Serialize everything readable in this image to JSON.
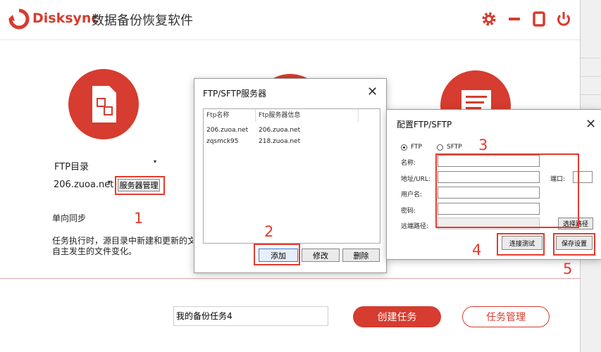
{
  "app": {
    "brand": "Disksync",
    "title": "数据备份恢复软件",
    "controls": {
      "settings": "gear-icon",
      "minimize": "minimize-icon",
      "maximize": "maximize-icon",
      "power": "power-icon"
    }
  },
  "left_panel": {
    "dir_type": "FTP目录",
    "server_value": "206.zuoa.net",
    "server_btn": "服务器管理",
    "mode": "单向同步",
    "desc_line1": "任务执行时，源目录中新建和更新的文",
    "desc_line2": "自主发生的文件变化。"
  },
  "bottom": {
    "task_name": "我的备份任务4",
    "create_btn": "创建任务",
    "manage_btn": "任务管理"
  },
  "ftp_dialog": {
    "title": "FTP/SFTP服务器",
    "col_name": "Ftp名称",
    "col_info": "Ftp服务器信息",
    "rows": [
      {
        "name": "206.zuoa.net",
        "info": "206.zuoa.net"
      },
      {
        "name": "zqsmck95",
        "info": "218.zuoa.net"
      }
    ],
    "add_btn": "添加",
    "edit_btn": "修改",
    "delete_btn": "删除"
  },
  "config_dialog": {
    "title": "配置FTP/SFTP",
    "radio_ftp": "FTP",
    "radio_sftp": "SFTP",
    "label_name": "名称:",
    "label_url": "地址/URL:",
    "label_port": "端口:",
    "label_user": "用户名:",
    "label_pass": "密码:",
    "label_remote": "远端路径:",
    "choose_path_btn": "选择路径",
    "test_btn": "连接测试",
    "save_btn": "保存设置"
  },
  "annotations": [
    "1",
    "2",
    "3",
    "4",
    "5"
  ],
  "colors": {
    "brand_red": "#d63c2f",
    "annotation_red": "#e53a2c"
  }
}
